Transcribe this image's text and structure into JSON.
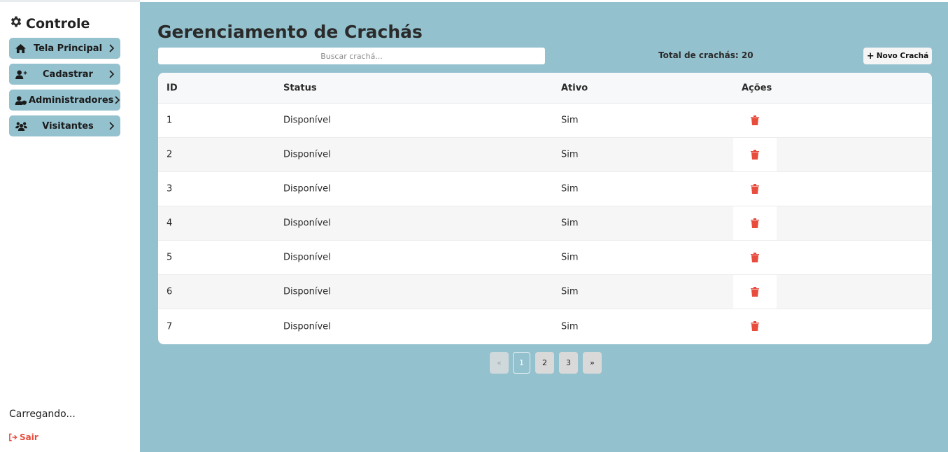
{
  "sidebar": {
    "brand": "Controle",
    "items": [
      {
        "label": "Tela Principal",
        "icon": "home-icon"
      },
      {
        "label": "Cadastrar",
        "icon": "user-plus-icon"
      },
      {
        "label": "Administradores",
        "icon": "user-shield-icon"
      },
      {
        "label": "Visitantes",
        "icon": "users-icon"
      }
    ],
    "loading_text": "Carregando...",
    "logout_label": "Sair"
  },
  "main": {
    "title": "Gerenciamento de Crachás",
    "search_placeholder": "Buscar crachá...",
    "total_label": "Total de crachás: 20",
    "new_button_label": "Novo Crachá",
    "table": {
      "headers": [
        "ID",
        "Status",
        "Ativo",
        "Ações"
      ],
      "rows": [
        {
          "id": "1",
          "status": "Disponível",
          "ativo": "Sim"
        },
        {
          "id": "2",
          "status": "Disponível",
          "ativo": "Sim"
        },
        {
          "id": "3",
          "status": "Disponível",
          "ativo": "Sim"
        },
        {
          "id": "4",
          "status": "Disponível",
          "ativo": "Sim"
        },
        {
          "id": "5",
          "status": "Disponível",
          "ativo": "Sim"
        },
        {
          "id": "6",
          "status": "Disponível",
          "ativo": "Sim"
        },
        {
          "id": "7",
          "status": "Disponível",
          "ativo": "Sim"
        }
      ]
    },
    "pagination": {
      "prev": "«",
      "pages": [
        "1",
        "2",
        "3"
      ],
      "current": "1",
      "next": "»"
    }
  },
  "colors": {
    "accent": "#94c1ce",
    "danger": "#e74c3c"
  }
}
